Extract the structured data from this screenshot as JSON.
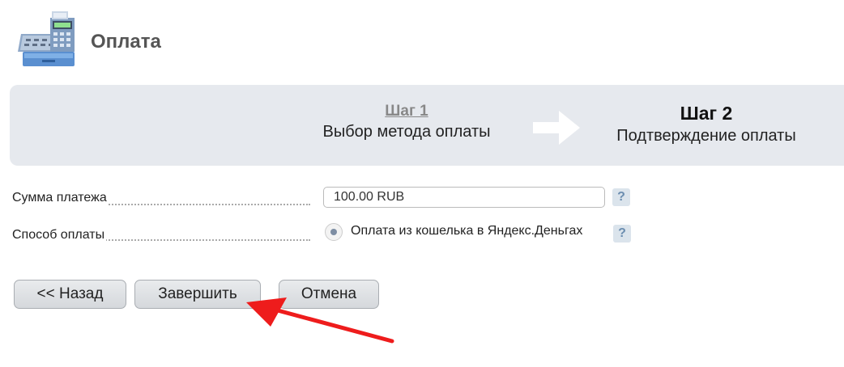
{
  "header": {
    "title": "Оплата",
    "logo_icon": "cash-register-icon"
  },
  "steps": {
    "step1": {
      "number": "Шаг 1",
      "description": "Выбор метода оплаты"
    },
    "step2": {
      "number": "Шаг 2",
      "description": "Подтверждение оплаты"
    },
    "arrow_icon": "arrow-right-icon"
  },
  "form": {
    "amount": {
      "label": "Сумма платежа",
      "value": "100.00 RUB",
      "help": "?"
    },
    "method": {
      "label": "Способ оплаты",
      "option": "Оплата из кошелька в Яндекс.Деньгах",
      "help": "?"
    }
  },
  "buttons": {
    "back": "<< Назад",
    "finish": "Завершить",
    "cancel": "Отмена"
  },
  "colors": {
    "step_bar": "#e6e9ee",
    "annotation_arrow": "#ee1c1c",
    "help_icon": "#6c8eb0"
  }
}
